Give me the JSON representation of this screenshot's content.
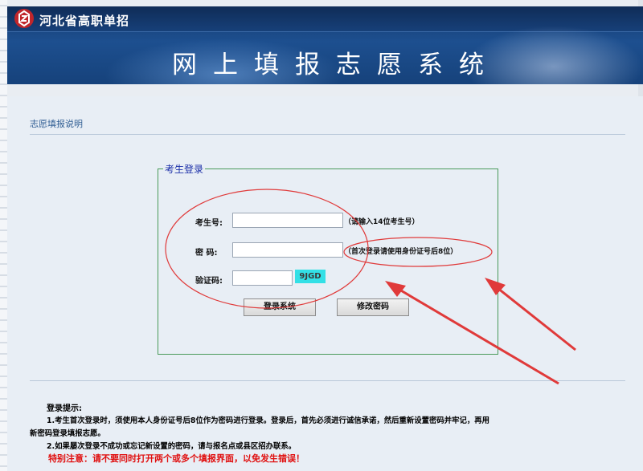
{
  "header": {
    "site_name": "河北省高职单招",
    "system_title": "网上填报志愿系统"
  },
  "panel": {
    "heading": "志愿填报说明"
  },
  "login": {
    "legend": "考生登录",
    "exam_no_label": "考生号:",
    "exam_no_value": "",
    "exam_no_hint": "（请输入14位考生号）",
    "password_label": "密 码:",
    "password_value": "",
    "password_hint": "（首次登录请使用身份证号后8位）",
    "captcha_label": "验证码:",
    "captcha_value": "",
    "captcha_image_text": "9JGD",
    "login_button": "登录系统",
    "change_password_button": "修改密码"
  },
  "tips": {
    "title": "登录提示:",
    "line1a": "1.考生首次登录时，须使用本人身份证号后8位作为密码进行登录。登录后，首先必须进行诚信承诺，然后重新设置密码并牢记，再用",
    "line1b": "新密码登录填报志愿。",
    "line2": "2.如果屡次登录不成功或忘记新设置的密码，请与报名点或县区招办联系。",
    "warning": "特别注意：请不要同时打开两个或多个填报界面，以免发生错误！"
  },
  "colors": {
    "banner": "#1d4f8f",
    "legend": "#1b2fa8",
    "frame": "#4a9a5a",
    "annotation": "#e03a3a",
    "captcha_bg": "#33e0e6",
    "warning": "#e01010"
  }
}
